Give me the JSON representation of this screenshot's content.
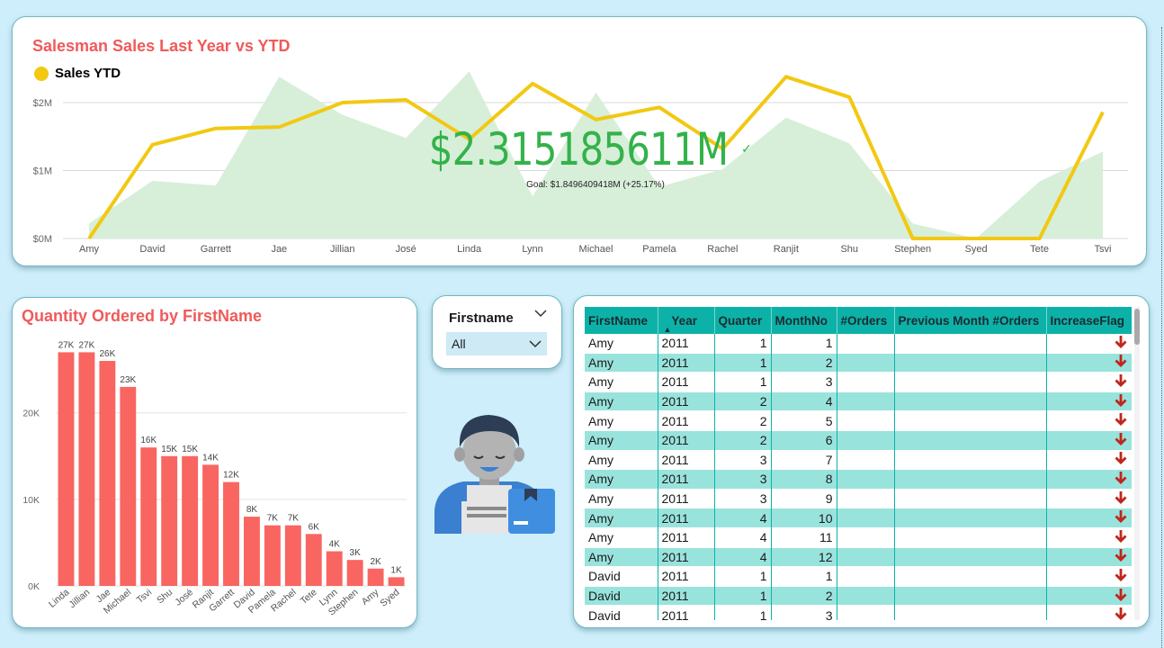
{
  "sales_chart": {
    "title": "Salesman Sales Last Year vs YTD",
    "legend_label": "Sales YTD",
    "kpi_value": "$2.315185611M",
    "kpi_goal": "Goal: $1.8496409418M (+25.17%)",
    "colors": {
      "line": "#f2c811",
      "area": "#d7efd9",
      "kpi": "#33b24a",
      "title": "#f05a5a"
    },
    "chart_data": {
      "type": "line",
      "categories": [
        "Amy",
        "David",
        "Garrett",
        "Jae",
        "Jillian",
        "José",
        "Linda",
        "Lynn",
        "Michael",
        "Pamela",
        "Rachel",
        "Ranjit",
        "Shu",
        "Stephen",
        "Syed",
        "Tete",
        "Tsvi"
      ],
      "series": [
        {
          "name": "Sales YTD",
          "values": [
            0.0,
            1.38,
            1.62,
            1.64,
            2.0,
            2.04,
            1.46,
            2.28,
            1.75,
            1.93,
            1.32,
            2.38,
            2.08,
            0.0,
            0.0,
            0.0,
            1.86
          ]
        },
        {
          "values": [
            0.22,
            0.85,
            0.78,
            2.38,
            1.82,
            1.48,
            2.46,
            0.62,
            2.15,
            0.76,
            1.02,
            1.78,
            1.4,
            0.22,
            0.0,
            0.84,
            1.28
          ]
        }
      ],
      "y_ticks": [
        "$0M",
        "$1M",
        "$2M"
      ],
      "ylim": [
        0,
        2.55
      ],
      "grid": true
    }
  },
  "qty_chart": {
    "title": "Quantity Ordered by FirstName",
    "colors": {
      "bar": "#f96560"
    },
    "chart_data": {
      "type": "bar",
      "categories": [
        "Linda",
        "Jillian",
        "Jae",
        "Michael",
        "Tsvi",
        "Shu",
        "José",
        "Ranjit",
        "Garrett",
        "David",
        "Pamela",
        "Rachel",
        "Tete",
        "Lynn",
        "Stephen",
        "Amy",
        "Syed"
      ],
      "values": [
        27000,
        27000,
        26000,
        23000,
        16000,
        15000,
        15000,
        14000,
        12000,
        8000,
        7000,
        7000,
        6000,
        4000,
        3000,
        2000,
        1000
      ],
      "data_labels": [
        "27K",
        "27K",
        "26K",
        "23K",
        "16K",
        "15K",
        "15K",
        "14K",
        "12K",
        "8K",
        "7K",
        "7K",
        "6K",
        "4K",
        "3K",
        "2K",
        "1K"
      ],
      "y_ticks": [
        "0K",
        "10K",
        "20K"
      ],
      "ylim": [
        0,
        28500
      ],
      "grid": true
    }
  },
  "slicer": {
    "title": "Firstname",
    "selected": "All"
  },
  "table": {
    "columns": [
      "FirstName",
      "Year",
      "Quarter",
      "MonthNo",
      "#Orders",
      "Previous Month #Orders",
      "IncreaseFlag"
    ],
    "rows": [
      [
        "Amy",
        "2011",
        "1",
        "1",
        "",
        ""
      ],
      [
        "Amy",
        "2011",
        "1",
        "2",
        "",
        ""
      ],
      [
        "Amy",
        "2011",
        "1",
        "3",
        "",
        ""
      ],
      [
        "Amy",
        "2011",
        "2",
        "4",
        "",
        ""
      ],
      [
        "Amy",
        "2011",
        "2",
        "5",
        "",
        ""
      ],
      [
        "Amy",
        "2011",
        "2",
        "6",
        "",
        ""
      ],
      [
        "Amy",
        "2011",
        "3",
        "7",
        "",
        ""
      ],
      [
        "Amy",
        "2011",
        "3",
        "8",
        "",
        ""
      ],
      [
        "Amy",
        "2011",
        "3",
        "9",
        "",
        ""
      ],
      [
        "Amy",
        "2011",
        "4",
        "10",
        "",
        ""
      ],
      [
        "Amy",
        "2011",
        "4",
        "11",
        "",
        ""
      ],
      [
        "Amy",
        "2011",
        "4",
        "12",
        "",
        ""
      ],
      [
        "David",
        "2011",
        "1",
        "1",
        "",
        ""
      ],
      [
        "David",
        "2011",
        "1",
        "2",
        "",
        ""
      ],
      [
        "David",
        "2011",
        "1",
        "3",
        "",
        ""
      ]
    ],
    "flag_icon": "down-arrow-icon",
    "flag_color": "#c0261b"
  }
}
